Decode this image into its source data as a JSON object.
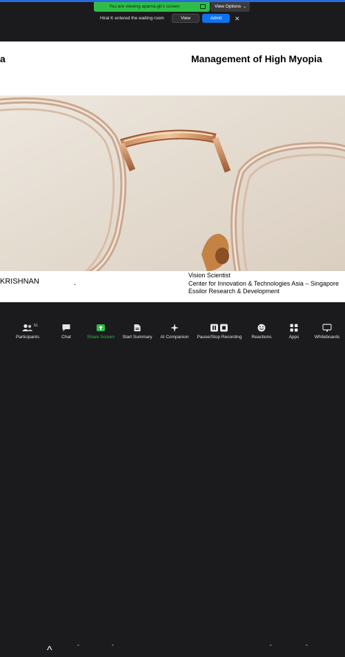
{
  "share_banner": {
    "text": "You are viewing aparna.gk's screen"
  },
  "view_options": {
    "label": "View Options"
  },
  "waiting_room": {
    "message": "Hiral K entered the waiting room",
    "view_label": "View",
    "admit_label": "Admit",
    "close_glyph": "✕"
  },
  "slide": {
    "title_left": "a",
    "title_main": "Management of High Myopia",
    "presenter_name": "KRISHNAN",
    "dot": ".",
    "affiliation": [
      "Vision Scientist",
      "Center for Innovation & Technologies Asia – Singapore",
      "Essilor Research & Development"
    ]
  },
  "toolbar": {
    "participants": {
      "label": "Participants",
      "count": "51"
    },
    "chat": {
      "label": "Chat"
    },
    "share_screen": {
      "label": "Share Screen"
    },
    "start_summary": {
      "label": "Start Summary"
    },
    "ai_companion": {
      "label": "AI Companion"
    },
    "recording": {
      "label": "Pause/Stop Recording"
    },
    "reactions": {
      "label": "Reactions"
    },
    "apps": {
      "label": "Apps"
    },
    "whiteboards": {
      "label": "Whiteboards"
    }
  },
  "colors": {
    "banner_green": "#2fbd48",
    "admit_blue": "#0e72ed",
    "frame_blue": "#2a6bdc",
    "toolbar_bg": "#1b1b1d"
  }
}
